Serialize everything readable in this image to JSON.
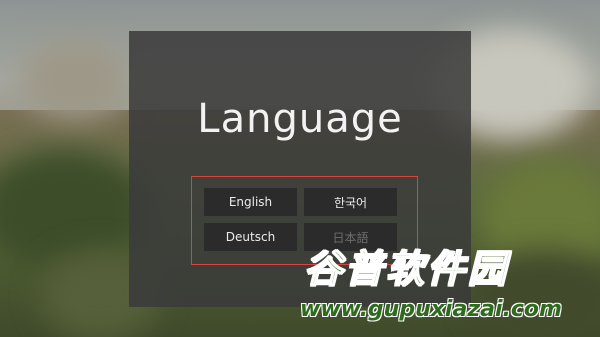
{
  "screen": {
    "title": "Language"
  },
  "languages": [
    {
      "label": "English",
      "enabled": true
    },
    {
      "label": "한국어",
      "enabled": true
    },
    {
      "label": "Deutsch",
      "enabled": true
    },
    {
      "label": "日本語",
      "enabled": false
    }
  ],
  "watermark": {
    "site_name": "谷普软件园",
    "url": "www.gupuxiazai.com"
  },
  "colors": {
    "panel": "#3a3a3a",
    "button": "#2b2b2b",
    "selection_frame": "#d9453c",
    "watermark_green": "#2e6b1f"
  }
}
